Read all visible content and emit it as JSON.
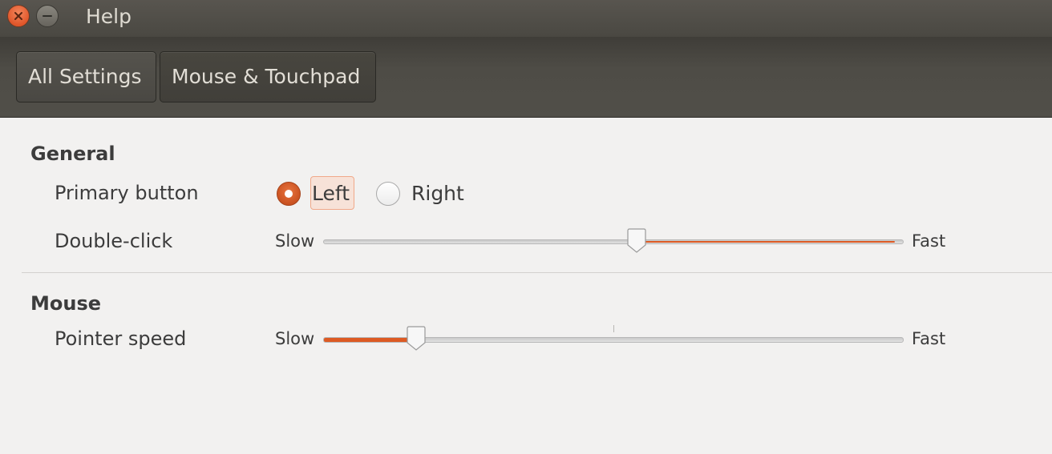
{
  "window": {
    "title": "Help",
    "close_icon": "close-icon",
    "minimize_icon": "minimize-icon"
  },
  "toolbar": {
    "all_settings_label": "All Settings",
    "current_label": "Mouse & Touchpad"
  },
  "general": {
    "heading": "General",
    "primary_button": {
      "label": "Primary button",
      "options": [
        "Left",
        "Right"
      ],
      "selected": "Left"
    },
    "double_click": {
      "label": "Double-click",
      "min_label": "Slow",
      "max_label": "Fast",
      "value": 0.54
    }
  },
  "mouse": {
    "heading": "Mouse",
    "pointer_speed": {
      "label": "Pointer speed",
      "min_label": "Slow",
      "max_label": "Fast",
      "value": 0.16
    }
  },
  "colors": {
    "accent": "#dd5a23",
    "titlebar": "#4a4842",
    "background": "#f2f1f0"
  }
}
